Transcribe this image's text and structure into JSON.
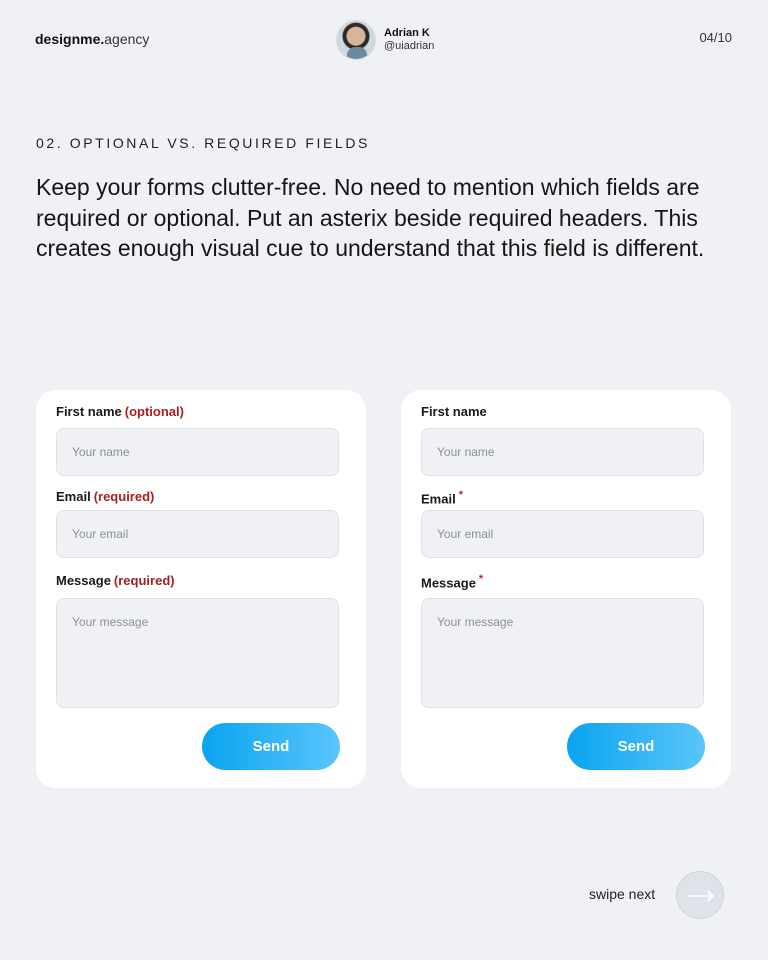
{
  "header": {
    "brand_bold": "designme.",
    "brand_light": "agency",
    "author_name": "Adrian K",
    "author_handle": "@uiadrian",
    "page": "04/10"
  },
  "section": {
    "label": "02. OPTIONAL VS. REQUIRED FIELDS",
    "lead": "Keep your forms clutter-free. No need to mention which fields are required or optional. Put an asterix beside required headers. This creates enough visual cue to understand that this field is different."
  },
  "left_form": {
    "first_name_label": "First name",
    "first_name_tag": "(optional)",
    "first_name_placeholder": "Your name",
    "email_label": "Email",
    "email_tag": "(required)",
    "email_placeholder": "Your email",
    "message_label": "Message",
    "message_tag": "(required)",
    "message_placeholder": "Your message",
    "send_label": "Send"
  },
  "right_form": {
    "first_name_label": "First name",
    "first_name_placeholder": "Your name",
    "email_label": "Email",
    "email_asterisk": "*",
    "email_placeholder": "Your email",
    "message_label": "Message",
    "message_asterisk": "*",
    "message_placeholder": "Your message",
    "send_label": "Send"
  },
  "footer": {
    "swipe_label": "swipe next",
    "next_icon": "arrow-right-icon"
  },
  "colors": {
    "background": "#f0f1f5",
    "card": "#ffffff",
    "tag": "#a52121",
    "button_start": "#0aa4f0",
    "button_end": "#5ac5fb"
  }
}
